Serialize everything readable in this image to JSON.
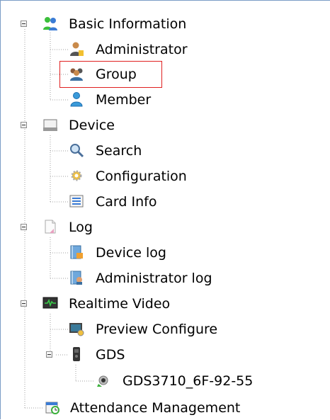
{
  "tree": {
    "items": [
      {
        "label": "Basic Information",
        "icon": "people-icon"
      },
      {
        "label": "Administrator",
        "icon": "admin-user-icon"
      },
      {
        "label": "Group",
        "icon": "group-icon"
      },
      {
        "label": "Member",
        "icon": "member-user-icon"
      },
      {
        "label": "Device",
        "icon": "device-icon"
      },
      {
        "label": "Search",
        "icon": "magnifier-icon"
      },
      {
        "label": "Configuration",
        "icon": "gear-icon"
      },
      {
        "label": "Card Info",
        "icon": "card-list-icon"
      },
      {
        "label": "Log",
        "icon": "log-document-icon"
      },
      {
        "label": "Device log",
        "icon": "device-log-icon"
      },
      {
        "label": "Administrator log",
        "icon": "admin-log-icon"
      },
      {
        "label": "Realtime Video",
        "icon": "monitor-icon"
      },
      {
        "label": "Preview Configure",
        "icon": "preview-configure-icon"
      },
      {
        "label": "GDS",
        "icon": "intercom-device-icon"
      },
      {
        "label": "GDS3710_6F-92-55",
        "icon": "camera-icon"
      },
      {
        "label": "Attendance Management",
        "icon": "calendar-clock-icon"
      }
    ],
    "selected_label": "Group",
    "colors": {
      "selection": "#e02020",
      "border": "#7a9cc6",
      "guides": "#a0a0a0"
    }
  }
}
